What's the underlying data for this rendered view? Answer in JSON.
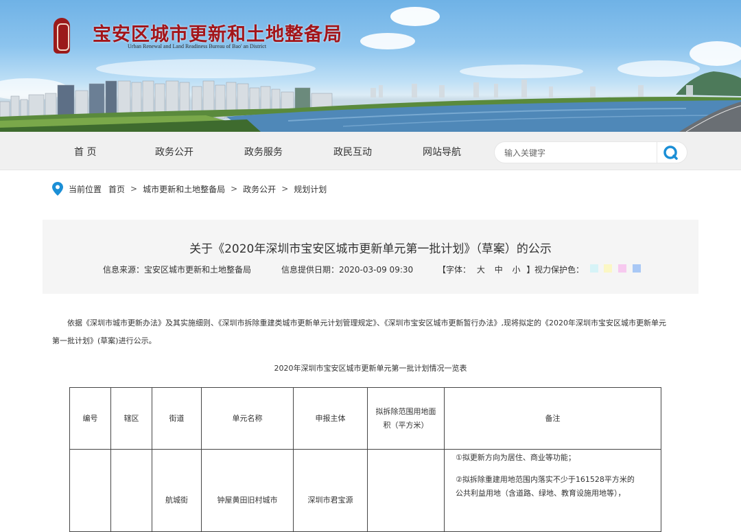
{
  "header": {
    "title": "宝安区城市更新和土地整备局",
    "subtitle": "Urban Renewal and Land Readiness Bureau of Bao' an District"
  },
  "nav": {
    "items": [
      "首 页",
      "政务公开",
      "政务服务",
      "政民互动",
      "网站导航"
    ],
    "search_placeholder": "输入关键字"
  },
  "breadcrumb": {
    "prefix": "当前位置",
    "items": [
      "首页",
      "城市更新和土地整备局",
      "政务公开",
      "规划计划"
    ]
  },
  "article": {
    "title": "关于《2020年深圳市宝安区城市更新单元第一批计划》（草案）的公示",
    "source": "信息来源：宝安区城市更新和土地整备局",
    "date": "信息提供日期：2020-03-09 09:30",
    "font_label": "【字体：",
    "font_sizes": [
      "大",
      "中",
      "小"
    ],
    "font_end": "】",
    "eye_label": "视力保护色：",
    "eye_colors": [
      "#d6f3f7",
      "#fbf7c4",
      "#f7c9ef",
      "#a9c8f5"
    ],
    "intro_line1": "依据《深圳市城市更新办法》及其实施细则、《深圳市拆除重建类城市更新单元计划管理规定》、《深圳市宝安区城市更新暂行办法》,现将拟定的《2020年深圳市宝安区城市更新单元",
    "intro_line2": "第一批计划》(草案)进行公示。",
    "table_title": "2020年深圳市宝安区城市更新单元第一批计划情况一览表"
  },
  "table": {
    "headers": [
      "编号",
      "辖区",
      "街道",
      "单元名称",
      "申报主体",
      "拟拆除范围用地面积（平方米）",
      "备注"
    ],
    "row1": {
      "street": "航城街",
      "unit_name": "钟屋黄田旧村城市",
      "applicant": "深圳市君宝源",
      "remark_1": "①拟更新方向为居住、商业等功能；",
      "remark_2": "②拟拆除重建用地范围内落实不少于161528平方米的",
      "remark_3": "公共利益用地（含道路、绿地、教育设施用地等），"
    }
  },
  "colors": {
    "brand_red": "#a3151a",
    "nav_bg": "#f0f0f0",
    "search_icon": "#1b8fd6",
    "pin_icon": "#1b8fd6"
  }
}
